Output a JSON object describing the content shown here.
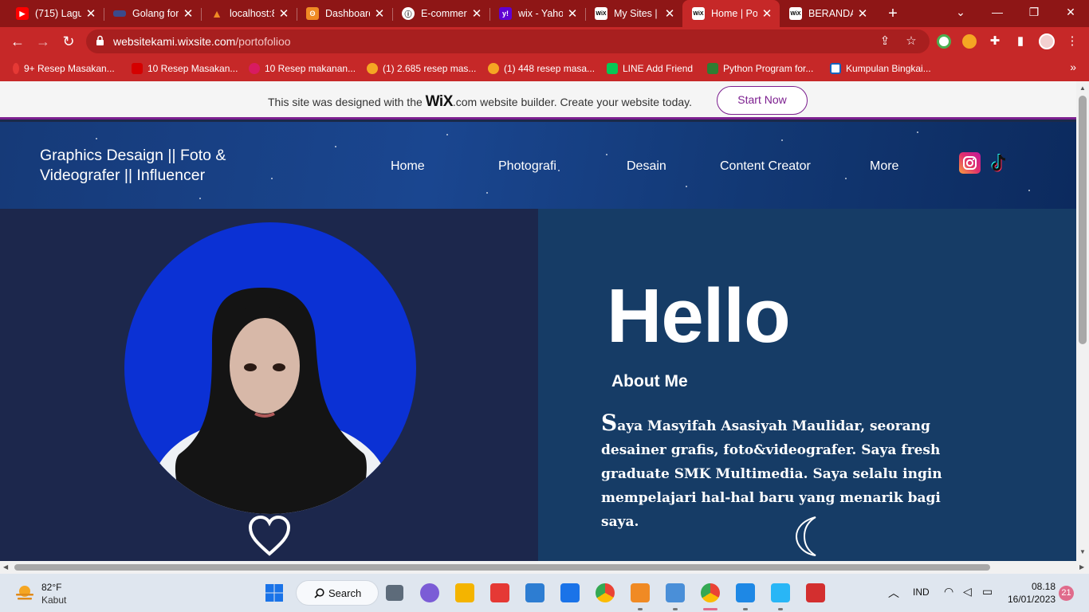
{
  "browser": {
    "tabs": [
      {
        "title": "(715) Lagu",
        "favicon": "youtube-icon",
        "color": "#ff0000"
      },
      {
        "title": "Golang for",
        "favicon": "flag-icon",
        "color": "#3b4a8c"
      },
      {
        "title": "localhost:8",
        "favicon": "xampp-icon",
        "color": "#f08a24"
      },
      {
        "title": "Dashboard",
        "favicon": "dashboard-icon",
        "color": "#f08a24"
      },
      {
        "title": "E-commer",
        "favicon": "github-icon",
        "color": "#ffffff"
      },
      {
        "title": "wix - Yaho",
        "favicon": "yahoo-icon",
        "color": "#6001d2"
      },
      {
        "title": "My Sites |",
        "favicon": "wix-icon",
        "color": "#ffffff"
      },
      {
        "title": "Home | Po",
        "favicon": "wix-icon",
        "color": "#ffffff"
      },
      {
        "title": "BERANDA",
        "favicon": "wix-icon",
        "color": "#ffffff"
      }
    ],
    "active_tab_index": 7,
    "url_host": "websitekami.wixsite.com",
    "url_path": "/portofolioo",
    "bookmarks": [
      {
        "label": "9+ Resep Masakan...",
        "color": "#e53935"
      },
      {
        "label": "10 Resep Masakan...",
        "color": "#d50000"
      },
      {
        "label": "10 Resep makanan...",
        "color": "#d81b60"
      },
      {
        "label": "(1) 2.685 resep mas...",
        "color": "#f5a623"
      },
      {
        "label": "(1) 448 resep masa...",
        "color": "#f5a623"
      },
      {
        "label": "LINE Add Friend",
        "color": "#06c755"
      },
      {
        "label": "Python Program for...",
        "color": "#2e7d32"
      },
      {
        "label": "Kumpulan Bingkai...",
        "color": "#1565c0"
      }
    ],
    "bookmarks_more": "»"
  },
  "wix_banner": {
    "prefix": "This site was designed with the",
    "logo": "WiX",
    "suffix": ".com website builder. Create your website today.",
    "cta": "Start Now"
  },
  "site": {
    "brand_line1": "Graphics Desaign || Foto &",
    "brand_line2": "Videografer || Influencer",
    "nav": [
      "Home",
      "Photografi",
      "Desain",
      "Content Creator",
      "More"
    ],
    "social": [
      "instagram-icon",
      "tiktok-icon"
    ],
    "hello": "Hello",
    "about_title": "About Me",
    "bio_drop": "S",
    "bio_rest": "aya Masyifah Asasiyah Maulidar, seorang desainer grafis, foto&videografer. Saya fresh graduate SMK Multimedia. Saya selalu ingin mempelajari hal-hal baru yang menarik bagi saya."
  },
  "taskbar": {
    "temperature": "82°F",
    "condition": "Kabut",
    "search_label": "Search",
    "language": "IND",
    "time": "08.18",
    "date": "16/01/2023",
    "notification_count": "21"
  },
  "colors": {
    "chrome_frame": "#8e1616",
    "chrome_toolbar": "#c62828",
    "wix_purple": "#7c1f8f",
    "header_blue": "#163a78",
    "left_panel": "#1c274c",
    "right_panel": "#163c66",
    "photo_circle": "#0b31d4"
  }
}
